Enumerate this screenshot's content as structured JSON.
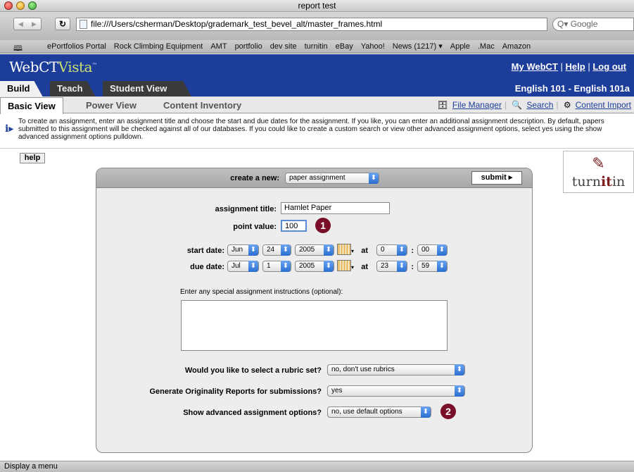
{
  "window": {
    "title": "report test"
  },
  "browser": {
    "url": "file:///Users/csherman/Desktop/grademark_test_bevel_alt/master_frames.html",
    "search_placeholder": "Google",
    "search_prefix": "Q▾",
    "bookmarks": [
      "ePortfolios Portal",
      "Rock Climbing Equipment",
      "AMT",
      "portfolio",
      "dev site",
      "turnitin",
      "eBay",
      "Yahoo!",
      "News (1217) ▾",
      "Apple",
      ".Mac",
      "Amazon"
    ]
  },
  "webct": {
    "logo_a": "WebCT",
    "logo_b": "Vista",
    "logo_tm": "™",
    "links": {
      "my": "My WebCT",
      "help": "Help",
      "logout": "Log out",
      "sep": "|"
    },
    "course": "English 101 - English 101a",
    "tabs": [
      "Build",
      "Teach",
      "Student View"
    ],
    "subtabs": [
      "Basic View",
      "Power View",
      "Content Inventory"
    ],
    "tools": {
      "file_manager": "File Manager",
      "search": "Search",
      "content_import": "Content Import"
    }
  },
  "info": {
    "text": "To create an assignment, enter an assignment title and choose the start and due dates for the assignment. If you like, you can enter an additional assignment description. By default, papers submitted to this assignment will be checked against all of our databases. If you could like to create a custom search or view other advanced assignment options, select yes using the show advanced assignment options pulldown."
  },
  "help_label": "help",
  "turnitin": {
    "pre": "turn",
    "bold": "it",
    "post": "in"
  },
  "form": {
    "create_label": "create a new:",
    "create_value": "paper assignment",
    "submit_label": "submit ▸",
    "title_label": "assignment title:",
    "title_value": "Hamlet Paper",
    "points_label": "point value:",
    "points_value": "100",
    "start_label": "start date:",
    "start": {
      "month": "Jun",
      "day": "24",
      "year": "2005",
      "hour": "0",
      "min": "00"
    },
    "due_label": "due date:",
    "due": {
      "month": "Jul",
      "day": "1",
      "year": "2005",
      "hour": "23",
      "min": "59"
    },
    "at_label": "at",
    "colon": ":",
    "instructions_label": "Enter any special assignment instructions (optional):",
    "rubric_label": "Would you like to select a rubric set?",
    "rubric_value": "no, don't use rubrics",
    "orig_label": "Generate Originality Reports for submissions?",
    "orig_value": "yes",
    "adv_label": "Show advanced assignment options?",
    "adv_value": "no, use default options"
  },
  "badges": [
    "1",
    "2"
  ],
  "status": "Display a menu",
  "colors": {
    "webct_blue": "#1d3d9a",
    "badge": "#7a1028",
    "accent": "#2a6ed0"
  }
}
